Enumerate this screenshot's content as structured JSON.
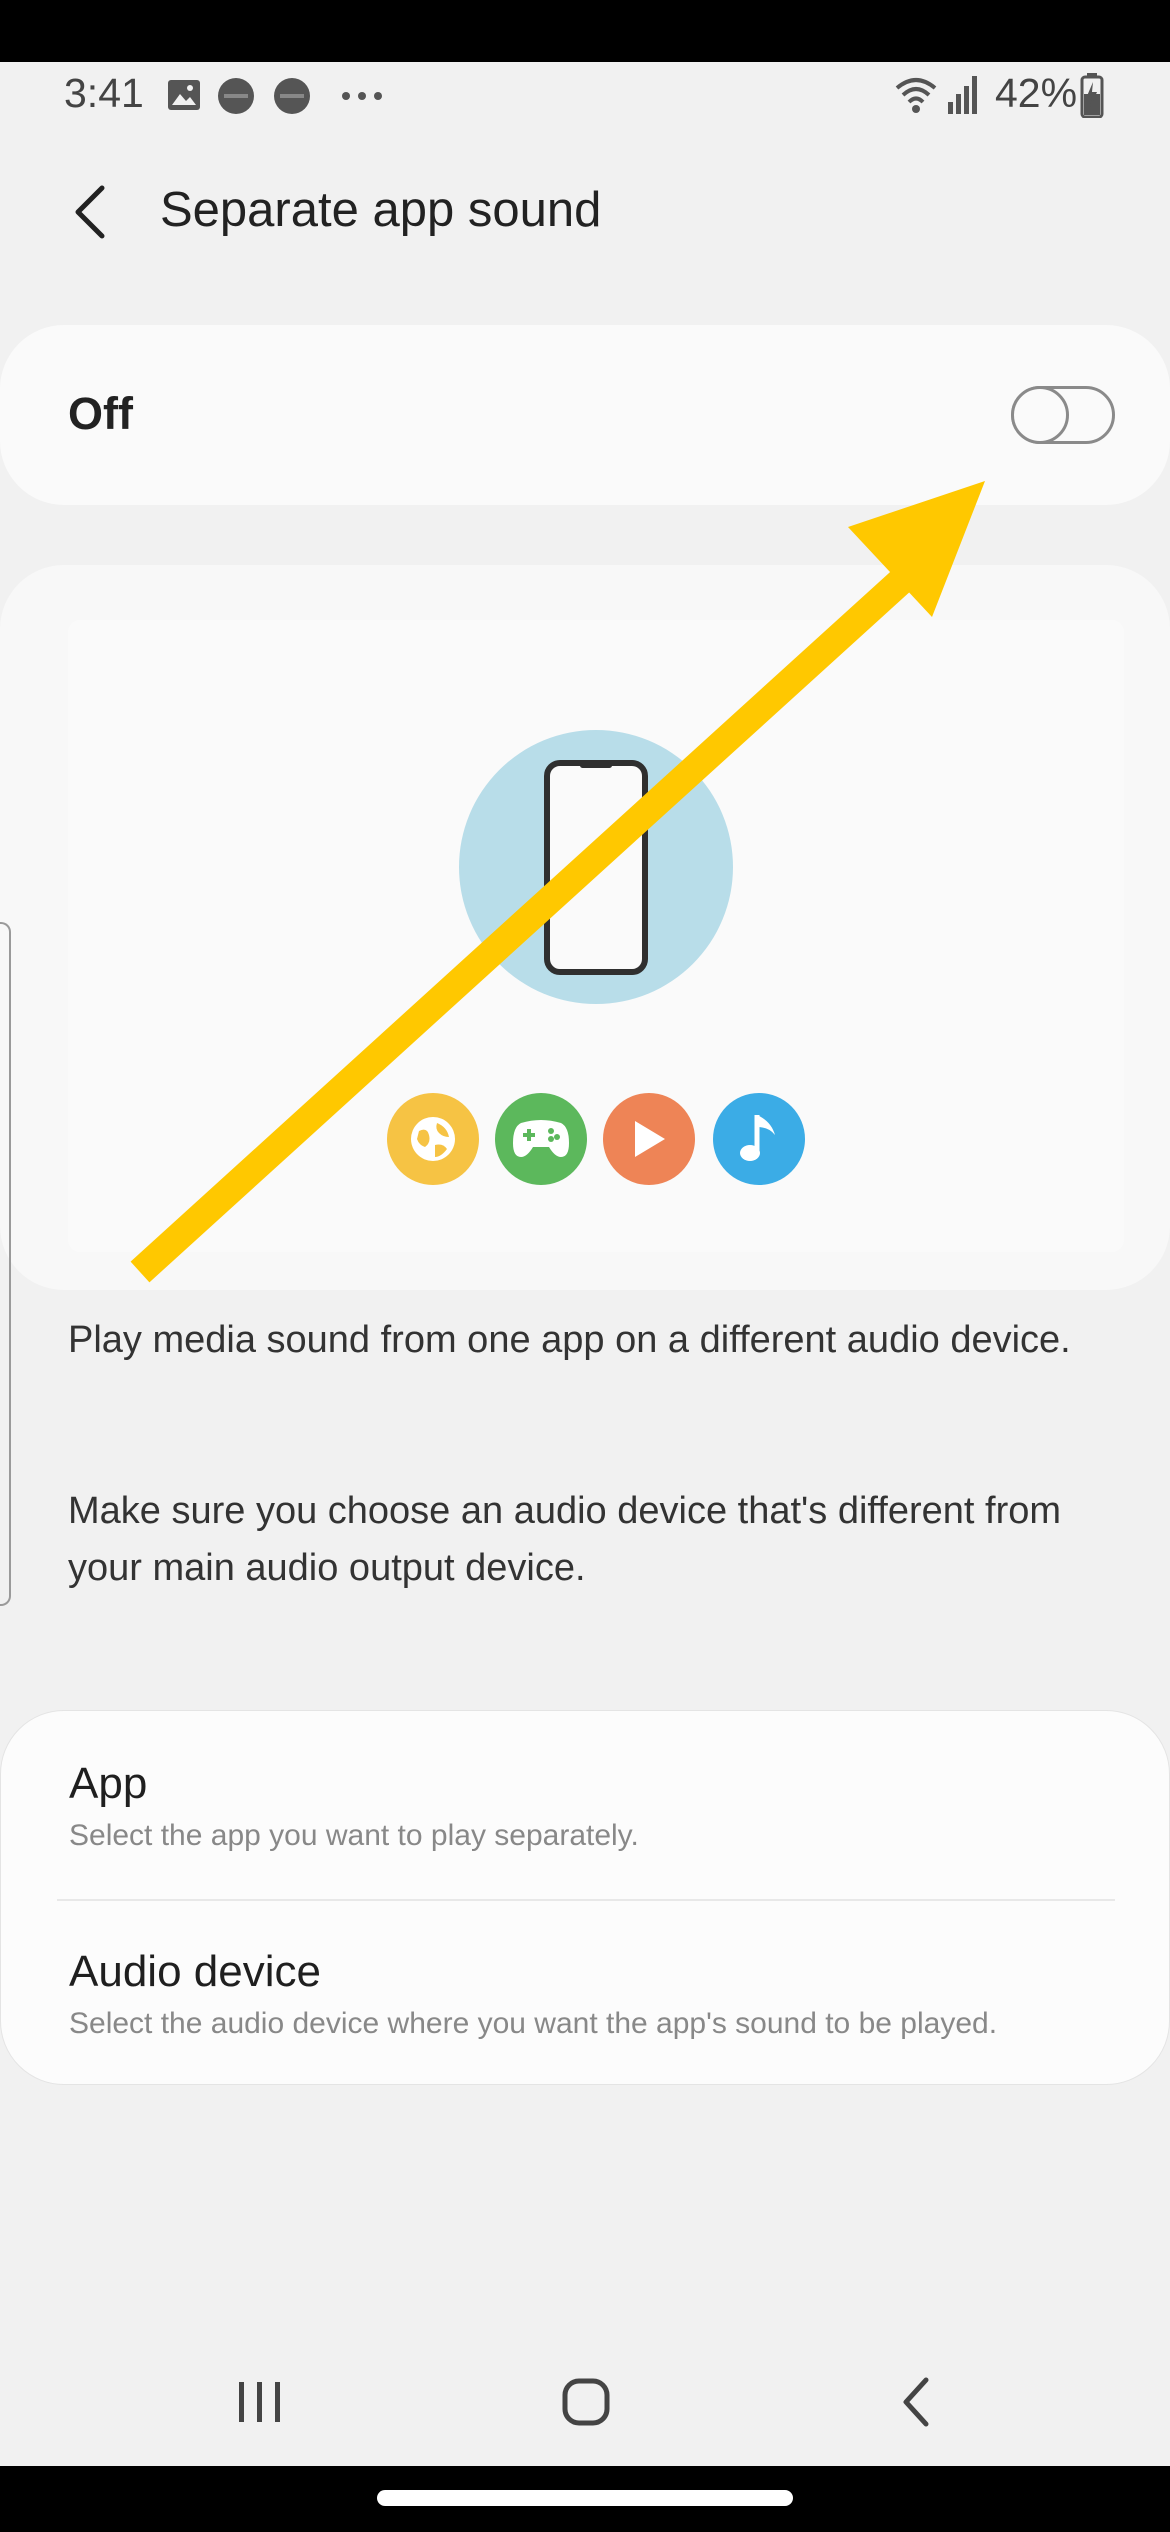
{
  "status_bar": {
    "time": "3:41",
    "battery_percent": "42%",
    "icons": [
      "gallery-icon",
      "notification-icon",
      "notification-icon",
      "more-dots-icon",
      "wifi-icon",
      "signal-icon",
      "battery-charging-icon"
    ]
  },
  "header": {
    "title": "Separate app sound",
    "back_icon": "chevron-left-icon"
  },
  "toggle": {
    "label": "Off",
    "state": false
  },
  "illustration": {
    "app_icons": [
      "internet-icon",
      "game-icon",
      "video-play-icon",
      "music-note-icon"
    ],
    "colors": {
      "circle": "#b8dde9",
      "internet": "#f6c344",
      "game": "#5cb85c",
      "video": "#ee8456",
      "music": "#3bace6"
    }
  },
  "description": {
    "paragraph1": "Play media sound from one app on a different audio device.",
    "paragraph2": "Make sure you choose an audio device that's different from your main audio output device."
  },
  "settings": {
    "app": {
      "title": "App",
      "subtitle": "Select the app you want to play separately."
    },
    "audio_device": {
      "title": "Audio device",
      "subtitle": "Select the audio device where you want the app's sound to be played."
    }
  },
  "nav_bar": {
    "icons": [
      "recent-apps-icon",
      "home-icon",
      "back-icon"
    ]
  },
  "annotation": {
    "arrow_color": "#ffc800"
  }
}
